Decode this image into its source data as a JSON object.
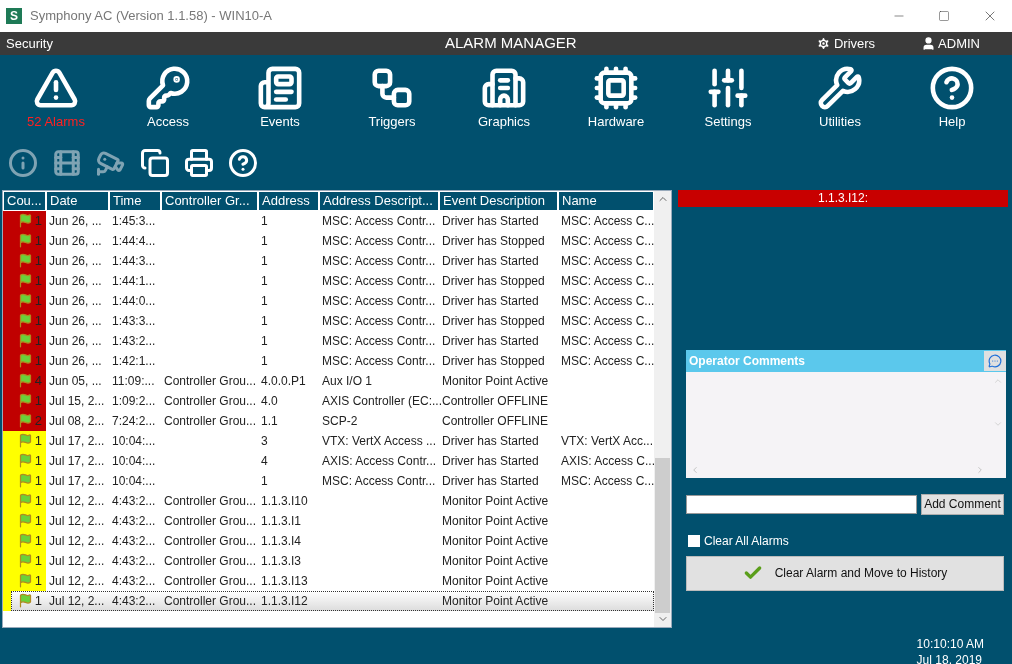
{
  "window": {
    "logo": "S",
    "title": "Symphony AC  (Version 1.1.58) - WIN10-A"
  },
  "header": {
    "left": "Security",
    "title": "ALARM MANAGER",
    "drivers": "Drivers",
    "user": "ADMIN"
  },
  "nav": [
    {
      "label": "52 Alarms",
      "kind": "alarms",
      "alert": true
    },
    {
      "label": "Access",
      "kind": "access",
      "alert": false
    },
    {
      "label": "Events",
      "kind": "events",
      "alert": false
    },
    {
      "label": "Triggers",
      "kind": "triggers",
      "alert": false
    },
    {
      "label": "Graphics",
      "kind": "graphics",
      "alert": false
    },
    {
      "label": "Hardware",
      "kind": "hardware",
      "alert": false
    },
    {
      "label": "Settings",
      "kind": "settings",
      "alert": false
    },
    {
      "label": "Utilities",
      "kind": "utilities",
      "alert": false
    },
    {
      "label": "Help",
      "kind": "help",
      "alert": false
    }
  ],
  "toolbar": [
    {
      "kind": "info",
      "disabled": true
    },
    {
      "kind": "video",
      "disabled": true
    },
    {
      "kind": "camera",
      "disabled": true
    },
    {
      "kind": "windows",
      "disabled": false
    },
    {
      "kind": "print",
      "disabled": false
    },
    {
      "kind": "help",
      "disabled": false
    }
  ],
  "table": {
    "columns": [
      "Cou...",
      "Date",
      "Time",
      "Controller Gr...",
      "Address",
      "Address Descript...",
      "Event Description",
      "Name"
    ],
    "rows": [
      {
        "color": "#c00000",
        "selected": false,
        "cells": [
          "1",
          "Jun 26, ...",
          "1:45:3...",
          "",
          "1",
          "MSC: Access Contr...",
          "Driver has Started",
          "MSC: Access C..."
        ]
      },
      {
        "color": "#c00000",
        "selected": false,
        "cells": [
          "1",
          "Jun 26, ...",
          "1:44:4...",
          "",
          "1",
          "MSC: Access Contr...",
          "Driver has Stopped",
          "MSC: Access C..."
        ]
      },
      {
        "color": "#c00000",
        "selected": false,
        "cells": [
          "1",
          "Jun 26, ...",
          "1:44:3...",
          "",
          "1",
          "MSC: Access Contr...",
          "Driver has Started",
          "MSC: Access C..."
        ]
      },
      {
        "color": "#c00000",
        "selected": false,
        "cells": [
          "1",
          "Jun 26, ...",
          "1:44:1...",
          "",
          "1",
          "MSC: Access Contr...",
          "Driver has Stopped",
          "MSC: Access C..."
        ]
      },
      {
        "color": "#c00000",
        "selected": false,
        "cells": [
          "1",
          "Jun 26, ...",
          "1:44:0...",
          "",
          "1",
          "MSC: Access Contr...",
          "Driver has Started",
          "MSC: Access C..."
        ]
      },
      {
        "color": "#c00000",
        "selected": false,
        "cells": [
          "1",
          "Jun 26, ...",
          "1:43:3...",
          "",
          "1",
          "MSC: Access Contr...",
          "Driver has Stopped",
          "MSC: Access C..."
        ]
      },
      {
        "color": "#c00000",
        "selected": false,
        "cells": [
          "1",
          "Jun 26, ...",
          "1:43:2...",
          "",
          "1",
          "MSC: Access Contr...",
          "Driver has Started",
          "MSC: Access C..."
        ]
      },
      {
        "color": "#c00000",
        "selected": false,
        "cells": [
          "1",
          "Jun 26, ...",
          "1:42:1...",
          "",
          "1",
          "MSC: Access Contr...",
          "Driver has Stopped",
          "MSC: Access C..."
        ]
      },
      {
        "color": "#c00000",
        "selected": false,
        "cells": [
          "4",
          "Jun 05, ...",
          "11:09:...",
          "Controller Grou...",
          "4.0.0.P1",
          "Aux I/O 1",
          "Monitor Point Active",
          ""
        ]
      },
      {
        "color": "#c00000",
        "selected": false,
        "cells": [
          "1",
          "Jul 15, 2...",
          "1:09:2...",
          "Controller Grou...",
          "4.0",
          "AXIS Controller (EC:...",
          "Controller OFFLINE",
          ""
        ]
      },
      {
        "color": "#c00000",
        "selected": false,
        "cells": [
          "2",
          "Jul 08, 2...",
          "7:24:2...",
          "Controller Grou...",
          "1.1",
          "SCP-2",
          "Controller OFFLINE",
          ""
        ]
      },
      {
        "color": "#ffff00",
        "selected": false,
        "cells": [
          "1",
          "Jul 17, 2...",
          "10:04:...",
          "",
          "3",
          "VTX: VertX Access ...",
          "Driver has Started",
          "VTX: VertX Acc..."
        ]
      },
      {
        "color": "#ffff00",
        "selected": false,
        "cells": [
          "1",
          "Jul 17, 2...",
          "10:04:...",
          "",
          "4",
          "AXIS: Access Contr...",
          "Driver has Started",
          "AXIS: Access C..."
        ]
      },
      {
        "color": "#ffff00",
        "selected": false,
        "cells": [
          "1",
          "Jul 17, 2...",
          "10:04:...",
          "",
          "1",
          "MSC: Access Contr...",
          "Driver has Started",
          "MSC: Access C..."
        ]
      },
      {
        "color": "#ffff00",
        "selected": false,
        "cells": [
          "1",
          "Jul 12, 2...",
          "4:43:2...",
          "Controller Grou...",
          "1.1.3.I10",
          "",
          "Monitor Point Active",
          ""
        ]
      },
      {
        "color": "#ffff00",
        "selected": false,
        "cells": [
          "1",
          "Jul 12, 2...",
          "4:43:2...",
          "Controller Grou...",
          "1.1.3.I1",
          "",
          "Monitor Point Active",
          ""
        ]
      },
      {
        "color": "#ffff00",
        "selected": false,
        "cells": [
          "1",
          "Jul 12, 2...",
          "4:43:2...",
          "Controller Grou...",
          "1.1.3.I4",
          "",
          "Monitor Point Active",
          ""
        ]
      },
      {
        "color": "#ffff00",
        "selected": false,
        "cells": [
          "1",
          "Jul 12, 2...",
          "4:43:2...",
          "Controller Grou...",
          "1.1.3.I3",
          "",
          "Monitor Point Active",
          ""
        ]
      },
      {
        "color": "#ffff00",
        "selected": false,
        "cells": [
          "1",
          "Jul 12, 2...",
          "4:43:2...",
          "Controller Grou...",
          "1.1.3.I13",
          "",
          "Monitor Point Active",
          ""
        ]
      },
      {
        "color": "#ffff00",
        "selected": true,
        "cells": [
          "1",
          "Jul 12, 2...",
          "4:43:2...",
          "Controller Grou...",
          "1.1.3.I12",
          "",
          "Monitor Point Active",
          ""
        ]
      }
    ]
  },
  "detail": {
    "title": "1.1.3.I12:"
  },
  "comments": {
    "title": "Operator Comments",
    "button": "Add Comment"
  },
  "clear_all": {
    "label": "Clear All Alarms",
    "checked": false
  },
  "clear_button": "Clear Alarm and Move to History",
  "clock": {
    "time": "10:10:10 AM",
    "date": "Jul 18, 2019"
  }
}
